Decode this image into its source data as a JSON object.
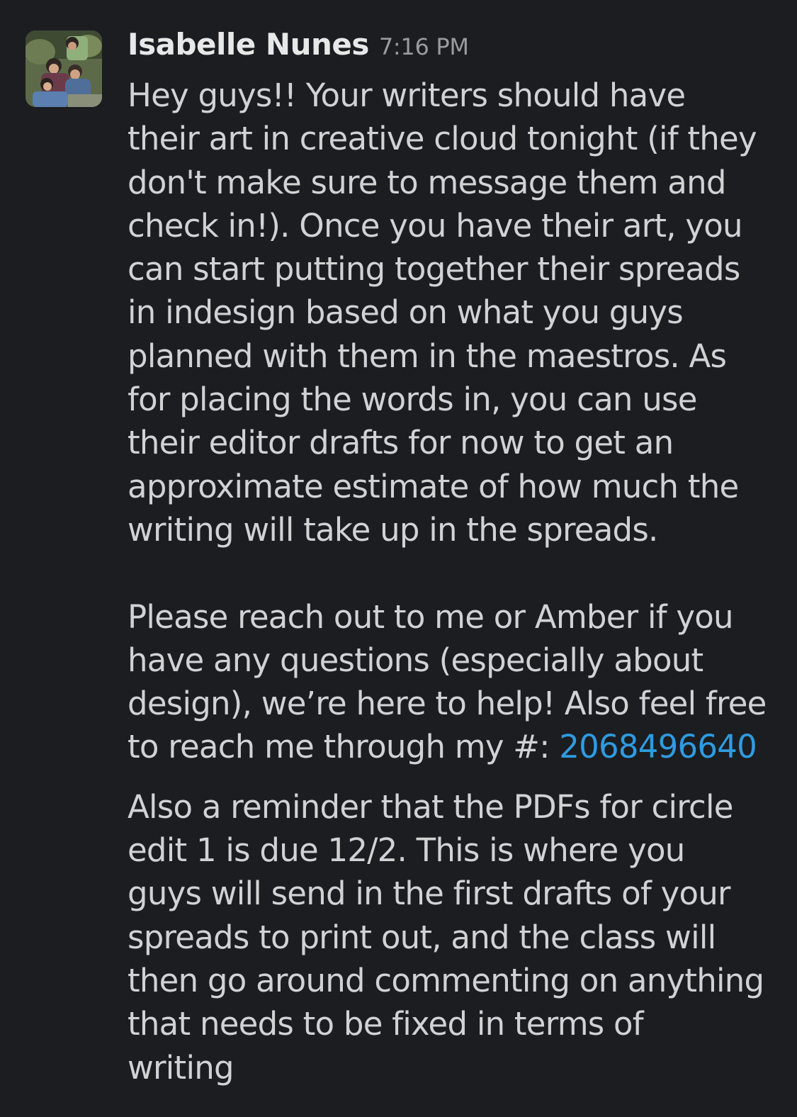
{
  "message": {
    "sender": "Isabelle Nunes",
    "timestamp": "7:16 PM",
    "paragraph1": [
      "Hey guys!! Your writers should have",
      "their art in creative cloud tonight (if they",
      "don't make sure to message them and",
      "check in!). Once you have their art, you",
      "can start putting together their spreads",
      "in indesign based on what you guys",
      "planned with them in the maestros. As",
      "for placing the words in, you can use",
      "their editor drafts for now to get an",
      "approximate estimate of how much the",
      "writing will take up in the spreads."
    ],
    "paragraph2": [
      "Please reach out to me or Amber if you",
      "have any questions (especially about",
      "design), we’re here to help! Also feel free"
    ],
    "paragraph2_last_prefix": "to reach me through my #: ",
    "phone_number": "2068496640",
    "paragraph3": [
      "Also a reminder that the PDFs for circle",
      "edit 1 is due 12/2. This is where you",
      "guys will send in the first drafts of your",
      "spreads to print out, and the class will",
      "then go around commenting on anything",
      "that needs to be fixed in terms of",
      "writing"
    ],
    "link_color": "#2f9be0"
  }
}
